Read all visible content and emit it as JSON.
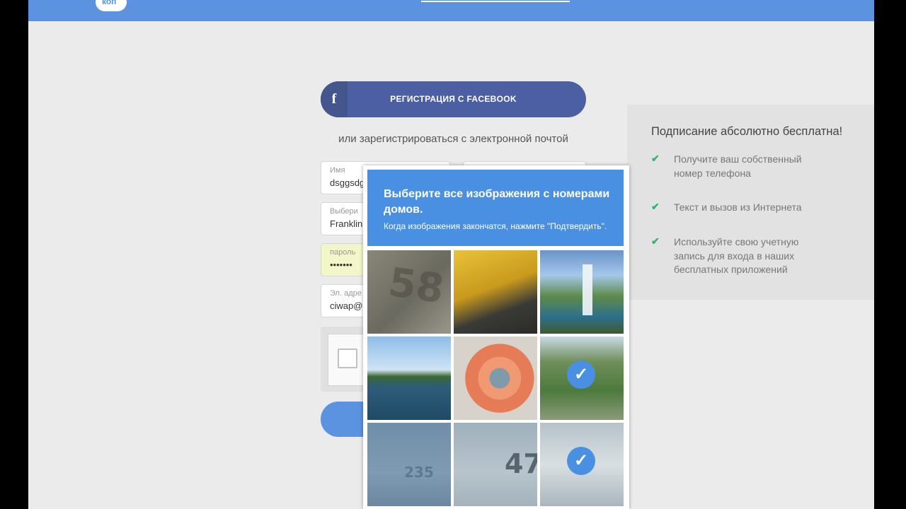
{
  "header": {
    "logo_text": "коп"
  },
  "facebook": {
    "icon": "f",
    "label": "РЕГИСТРАЦИЯ С FACEBOOK"
  },
  "or_text": "или зарегистрироваться с электронной почтой",
  "form": {
    "name": {
      "label": "Имя",
      "value": "dsggsdg"
    },
    "choose": {
      "label": "Выбери",
      "value": "Franklin"
    },
    "password": {
      "label": "пароль",
      "value": "•••••••"
    },
    "email": {
      "label": "Эл. адре",
      "value": "ciwap@"
    }
  },
  "side_panel": {
    "title": "Подписание абсолютно бесплатна!",
    "check_icon": "✔",
    "items": [
      "Получите ваш собственный номер телефона",
      "Текст и вызов из Интернета",
      "Используйте свою учетную запись для входа в наших бесплатных приложений"
    ]
  },
  "captcha": {
    "title": "Выберите все изображения с номерами домов.",
    "subtitle": "Когда изображения закончатся, нажмите \"Подтвердить\".",
    "check_mark": "✓",
    "tiles": [
      {
        "image": "house-number-stone-image",
        "number": "58",
        "selected": false
      },
      {
        "image": "yellow-fabric-image",
        "selected": false
      },
      {
        "image": "waterfall-image",
        "selected": false
      },
      {
        "image": "river-landscape-image",
        "selected": false
      },
      {
        "image": "flowers-bouquet-image",
        "selected": false
      },
      {
        "image": "town-aerial-image",
        "selected": true
      },
      {
        "image": "house-number-wall-image",
        "number": "235",
        "selected": false
      },
      {
        "image": "house-number-47-image",
        "number": "47",
        "selected": false
      },
      {
        "image": "building-facade-image",
        "selected": true
      }
    ]
  },
  "colors": {
    "accent": "#4a90e2",
    "facebook": "#4d5fa3",
    "check": "#2db56b"
  }
}
